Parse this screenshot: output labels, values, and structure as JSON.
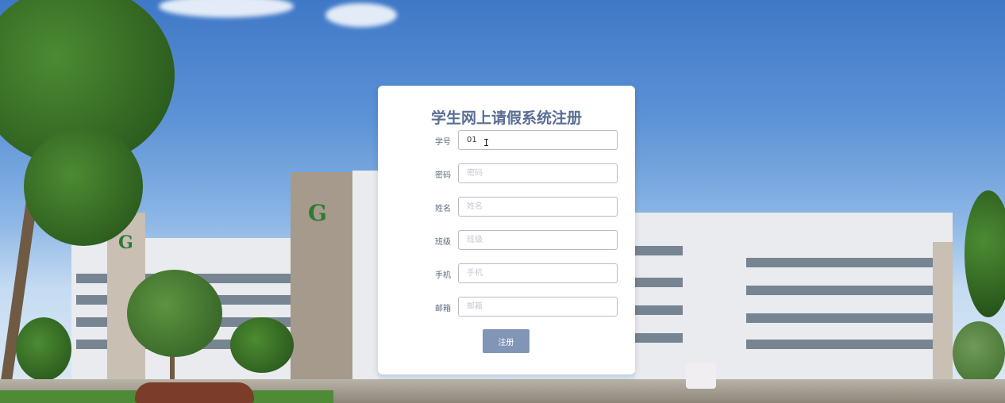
{
  "form": {
    "title": "学生网上请假系统注册",
    "fields": [
      {
        "label": "学号",
        "value": "01",
        "placeholder": ""
      },
      {
        "label": "密码",
        "value": "",
        "placeholder": "密码"
      },
      {
        "label": "姓名",
        "value": "",
        "placeholder": "姓名"
      },
      {
        "label": "班级",
        "value": "",
        "placeholder": "班级"
      },
      {
        "label": "手机",
        "value": "",
        "placeholder": "手机"
      },
      {
        "label": "邮箱",
        "value": "",
        "placeholder": "邮箱"
      }
    ],
    "submit_label": "注册"
  },
  "colors": {
    "title": "#5a6e94",
    "button": "#8195b7",
    "card": "#ffffff"
  },
  "background": {
    "icons": [
      "campus-building-photo"
    ]
  }
}
